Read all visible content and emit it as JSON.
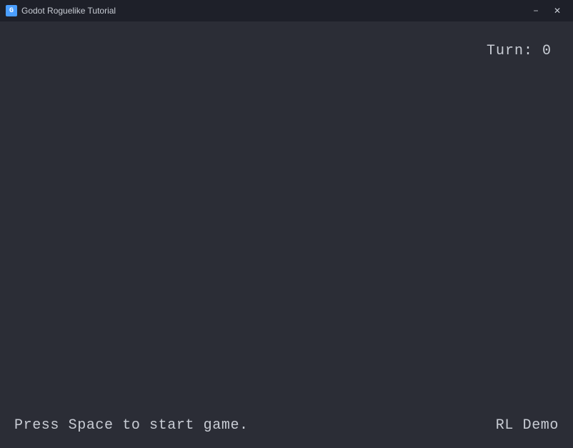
{
  "titlebar": {
    "title": "Godot Roguelike Tutorial",
    "icon_text": "G",
    "minimize_label": "−",
    "close_label": "✕"
  },
  "game": {
    "turn_label": "Turn: 0",
    "press_space_label": "Press Space to start game.",
    "rl_demo_label": "RL Demo"
  },
  "colors": {
    "background": "#2b2d36",
    "titlebar_bg": "#1e2029",
    "text": "#c8ccd4"
  }
}
